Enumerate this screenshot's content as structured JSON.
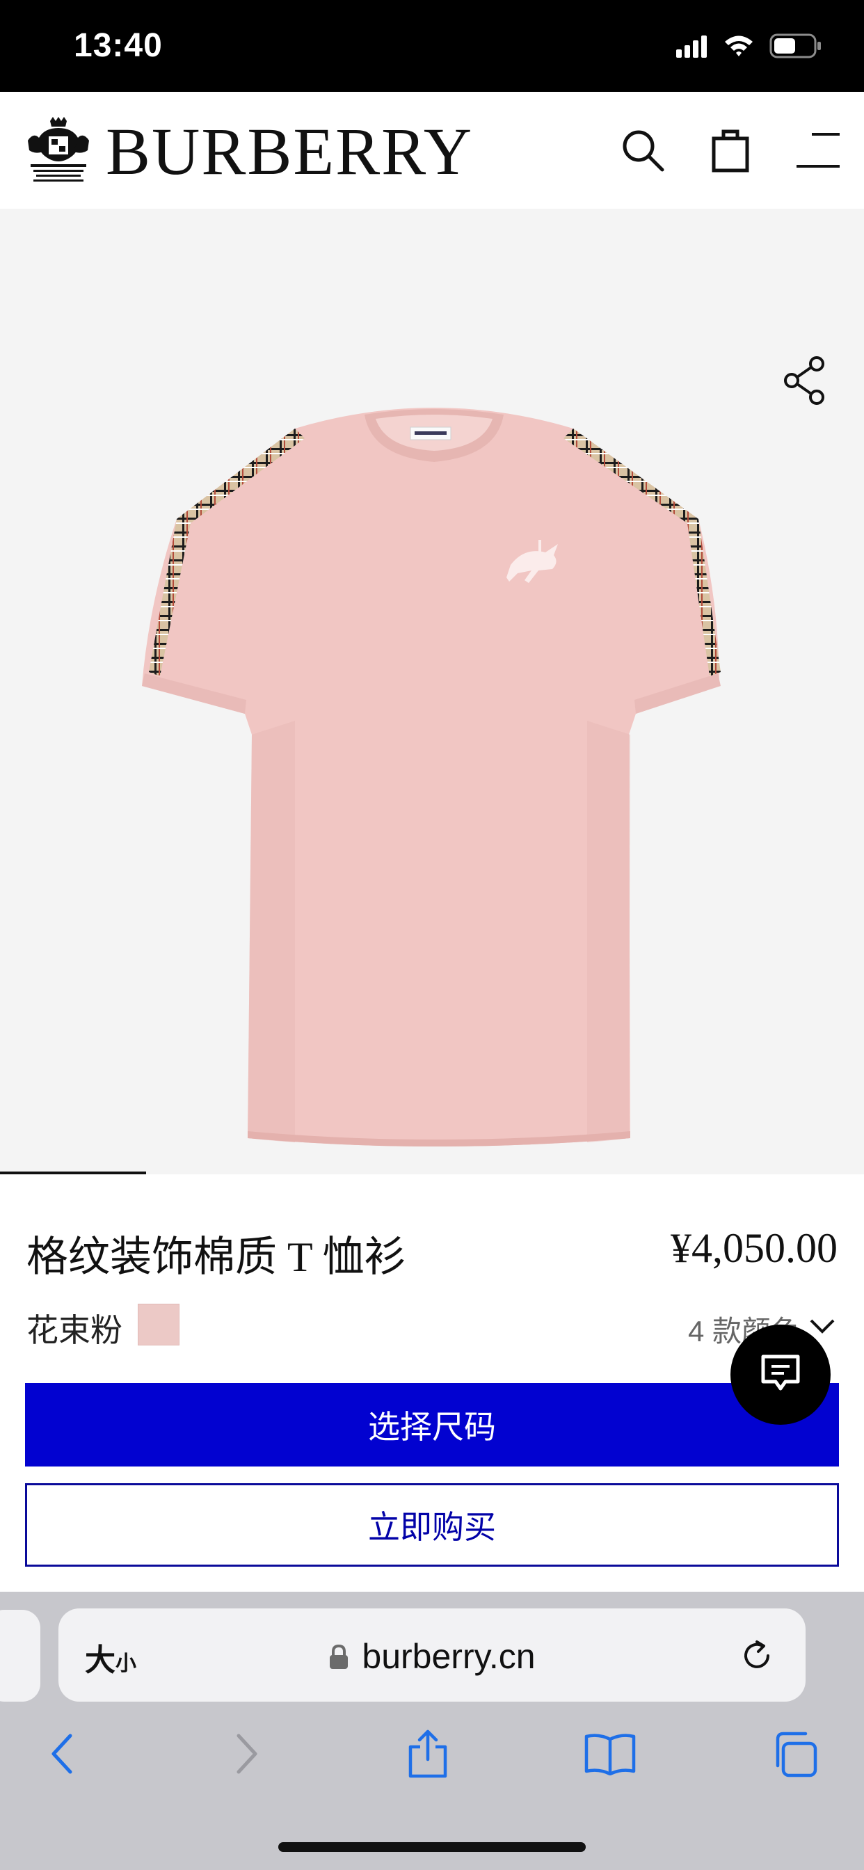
{
  "status_bar": {
    "time": "13:40",
    "icons": [
      "cellular-signal-icon",
      "wifi-icon",
      "battery-icon"
    ]
  },
  "header": {
    "brand": "BURBERRY",
    "crest_icon": "royal-warrant-crest-icon",
    "icons": [
      "search-icon",
      "shopping-bag-icon",
      "menu-icon"
    ]
  },
  "gallery": {
    "image_subject": "pink-check-trim-tshirt",
    "share_icon": "share-icon",
    "active_slide_indicator": true
  },
  "product": {
    "name": "格纹装饰棉质 T 恤衫",
    "price": "¥4,050.00",
    "color_name": "花束粉",
    "color_swatch": "#ecc9c6",
    "colors_count": "4 款颜色"
  },
  "actions": {
    "select_size_label": "选择尺码",
    "buy_now_label": "立即购买",
    "primary_color": "#0202d0"
  },
  "chat": {
    "icon": "chat-icon"
  },
  "browser": {
    "text_size_large": "大",
    "text_size_small": "小",
    "url": "burberry.cn",
    "nav_icons": [
      "back-icon",
      "forward-icon",
      "share-icon",
      "bookmarks-icon",
      "tabs-icon"
    ]
  }
}
